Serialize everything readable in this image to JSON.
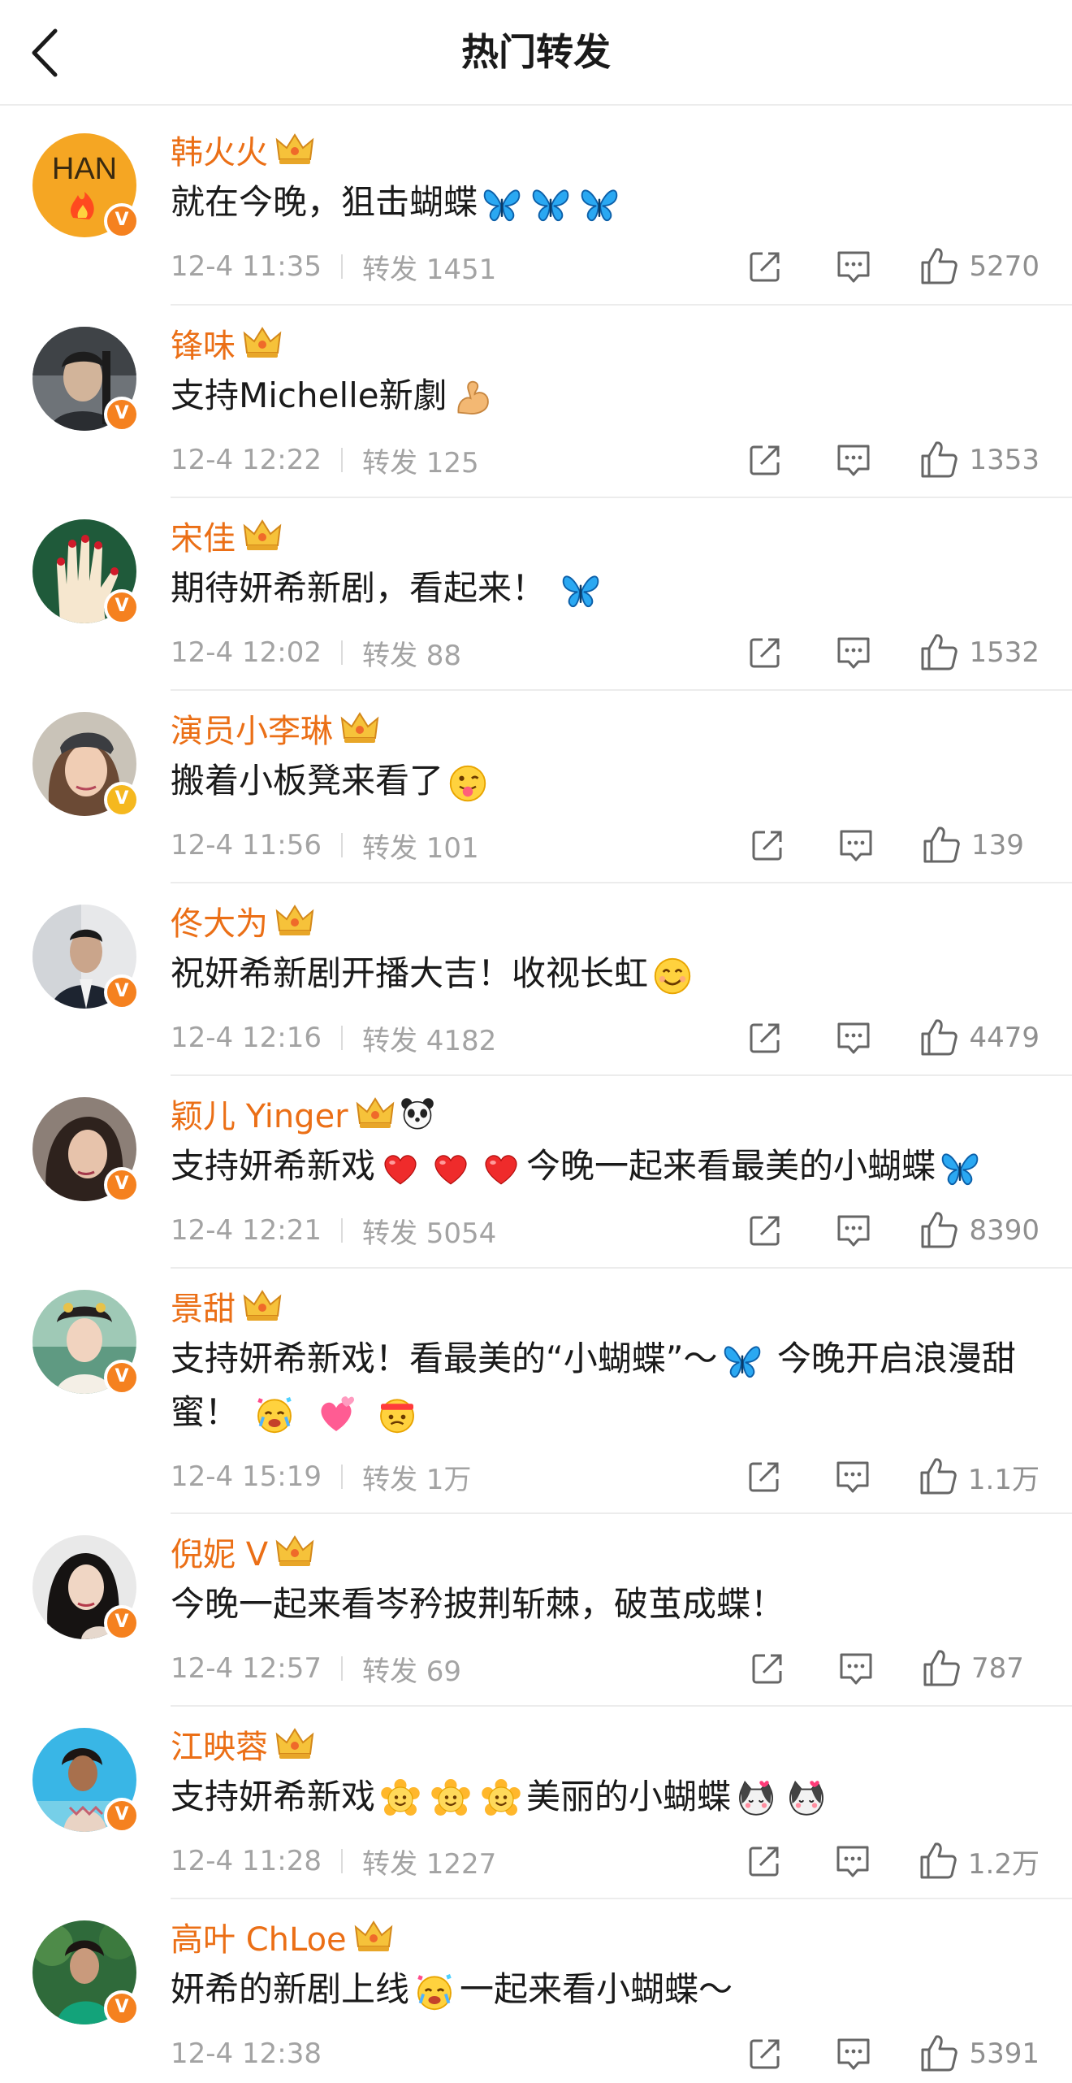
{
  "header": {
    "title": "热门转发"
  },
  "colors": {
    "name": "#eb6f16",
    "meta": "#a3a3a3",
    "badge": "#f5811f"
  },
  "items": [
    {
      "name": "韩火火",
      "text": "就在今晚，狙击蝴蝶",
      "time": "12-4 11:35",
      "repost": "转发 1451",
      "likes": "5270",
      "avatar_text": "HAN"
    },
    {
      "name": "锋味",
      "text_a": "支持Michelle新劇",
      "time": "12-4 12:22",
      "repost": "转发 125",
      "likes": "1353"
    },
    {
      "name": "宋佳",
      "text": "期待妍希新剧，看起来！",
      "time": "12-4 12:02",
      "repost": "转发 88",
      "likes": "1532"
    },
    {
      "name": "演员小李琳",
      "text": "搬着小板凳来看了",
      "time": "12-4 11:56",
      "repost": "转发 101",
      "likes": "139"
    },
    {
      "name": "佟大为",
      "text": "祝妍希新剧开播大吉！收视长虹",
      "time": "12-4 12:16",
      "repost": "转发 4182",
      "likes": "4479"
    },
    {
      "name": "颖儿 Yinger",
      "text_a": "支持妍希新戏",
      "text_b": "今晚一起来看最美的小蝴蝶",
      "time": "12-4 12:21",
      "repost": "转发 5054",
      "likes": "8390"
    },
    {
      "name": "景甜",
      "text_a": "支持妍希新戏！看最美的“小蝴蝶”～",
      "text_b": " 今晚开启浪漫甜蜜！",
      "time": "12-4 15:19",
      "repost": "转发 1万",
      "likes": "1.1万"
    },
    {
      "name": "倪妮 V",
      "text": "今晚一起来看岑矜披荆斩棘，破茧成蝶！",
      "time": "12-4 12:57",
      "repost": "转发 69",
      "likes": "787"
    },
    {
      "name": "江映蓉",
      "text_a": "支持妍希新戏",
      "text_b": "美丽的小蝴蝶",
      "time": "12-4 11:28",
      "repost": "转发 1227",
      "likes": "1.2万"
    },
    {
      "name": "高叶 ChLoe",
      "text_a": "妍希的新剧上线",
      "text_b": "一起来看小蝴蝶～",
      "time": "12-4 12:38",
      "repost": "",
      "likes": "5391"
    }
  ]
}
